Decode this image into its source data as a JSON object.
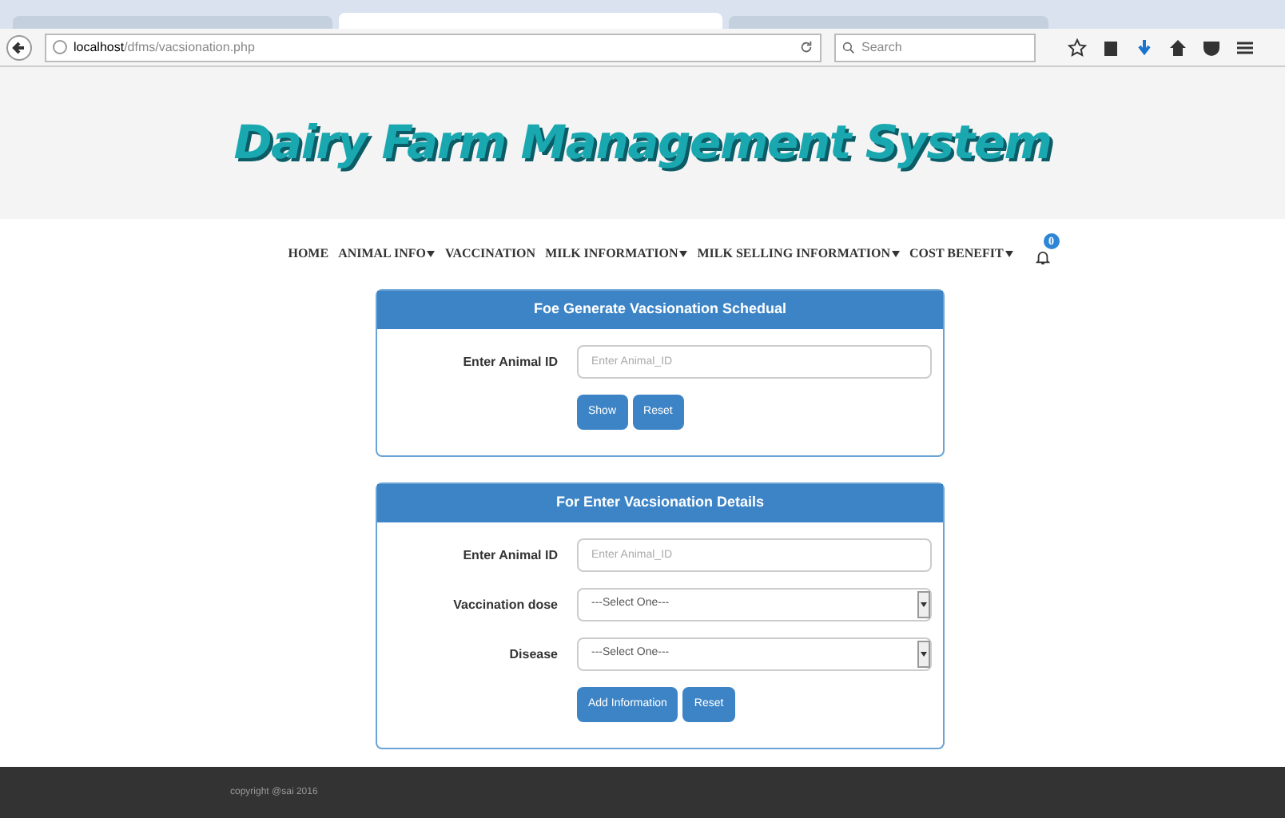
{
  "browser": {
    "url_host": "localhost",
    "url_path": "/dfms/vacsionation.php",
    "search_placeholder": "Search"
  },
  "browser_tabs": [
    {
      "selected": false
    },
    {
      "selected": true
    },
    {
      "selected": false
    }
  ],
  "site_title": "Dairy Farm Management System",
  "nav": [
    {
      "label": "HOME",
      "dropdown": false
    },
    {
      "label": "ANIMAL INFO",
      "dropdown": true
    },
    {
      "label": "VACCINATION",
      "dropdown": false
    },
    {
      "label": "MILK INFORMATION",
      "dropdown": true
    },
    {
      "label": "MILK SELLING INFORMATION",
      "dropdown": true
    },
    {
      "label": "COST BENEFIT",
      "dropdown": true
    }
  ],
  "notification_count": "0",
  "panels": [
    {
      "title": "Foe Generate Vacsionation Schedual",
      "fields": [
        {
          "kind": "text",
          "label": "Enter Animal ID",
          "placeholder": "Enter Animal_ID"
        }
      ],
      "buttons": [
        "Show",
        "Reset"
      ]
    },
    {
      "title": "For Enter Vacsionation Details",
      "fields": [
        {
          "kind": "text",
          "label": "Enter Animal ID",
          "placeholder": "Enter Animal_ID"
        },
        {
          "kind": "select",
          "label": "Vaccination dose",
          "value": "---Select One---"
        },
        {
          "kind": "select",
          "label": "Disease",
          "value": "---Select One---"
        }
      ],
      "buttons": [
        "Add Information",
        "Reset"
      ]
    }
  ],
  "footer": "copyright @sai 2016"
}
